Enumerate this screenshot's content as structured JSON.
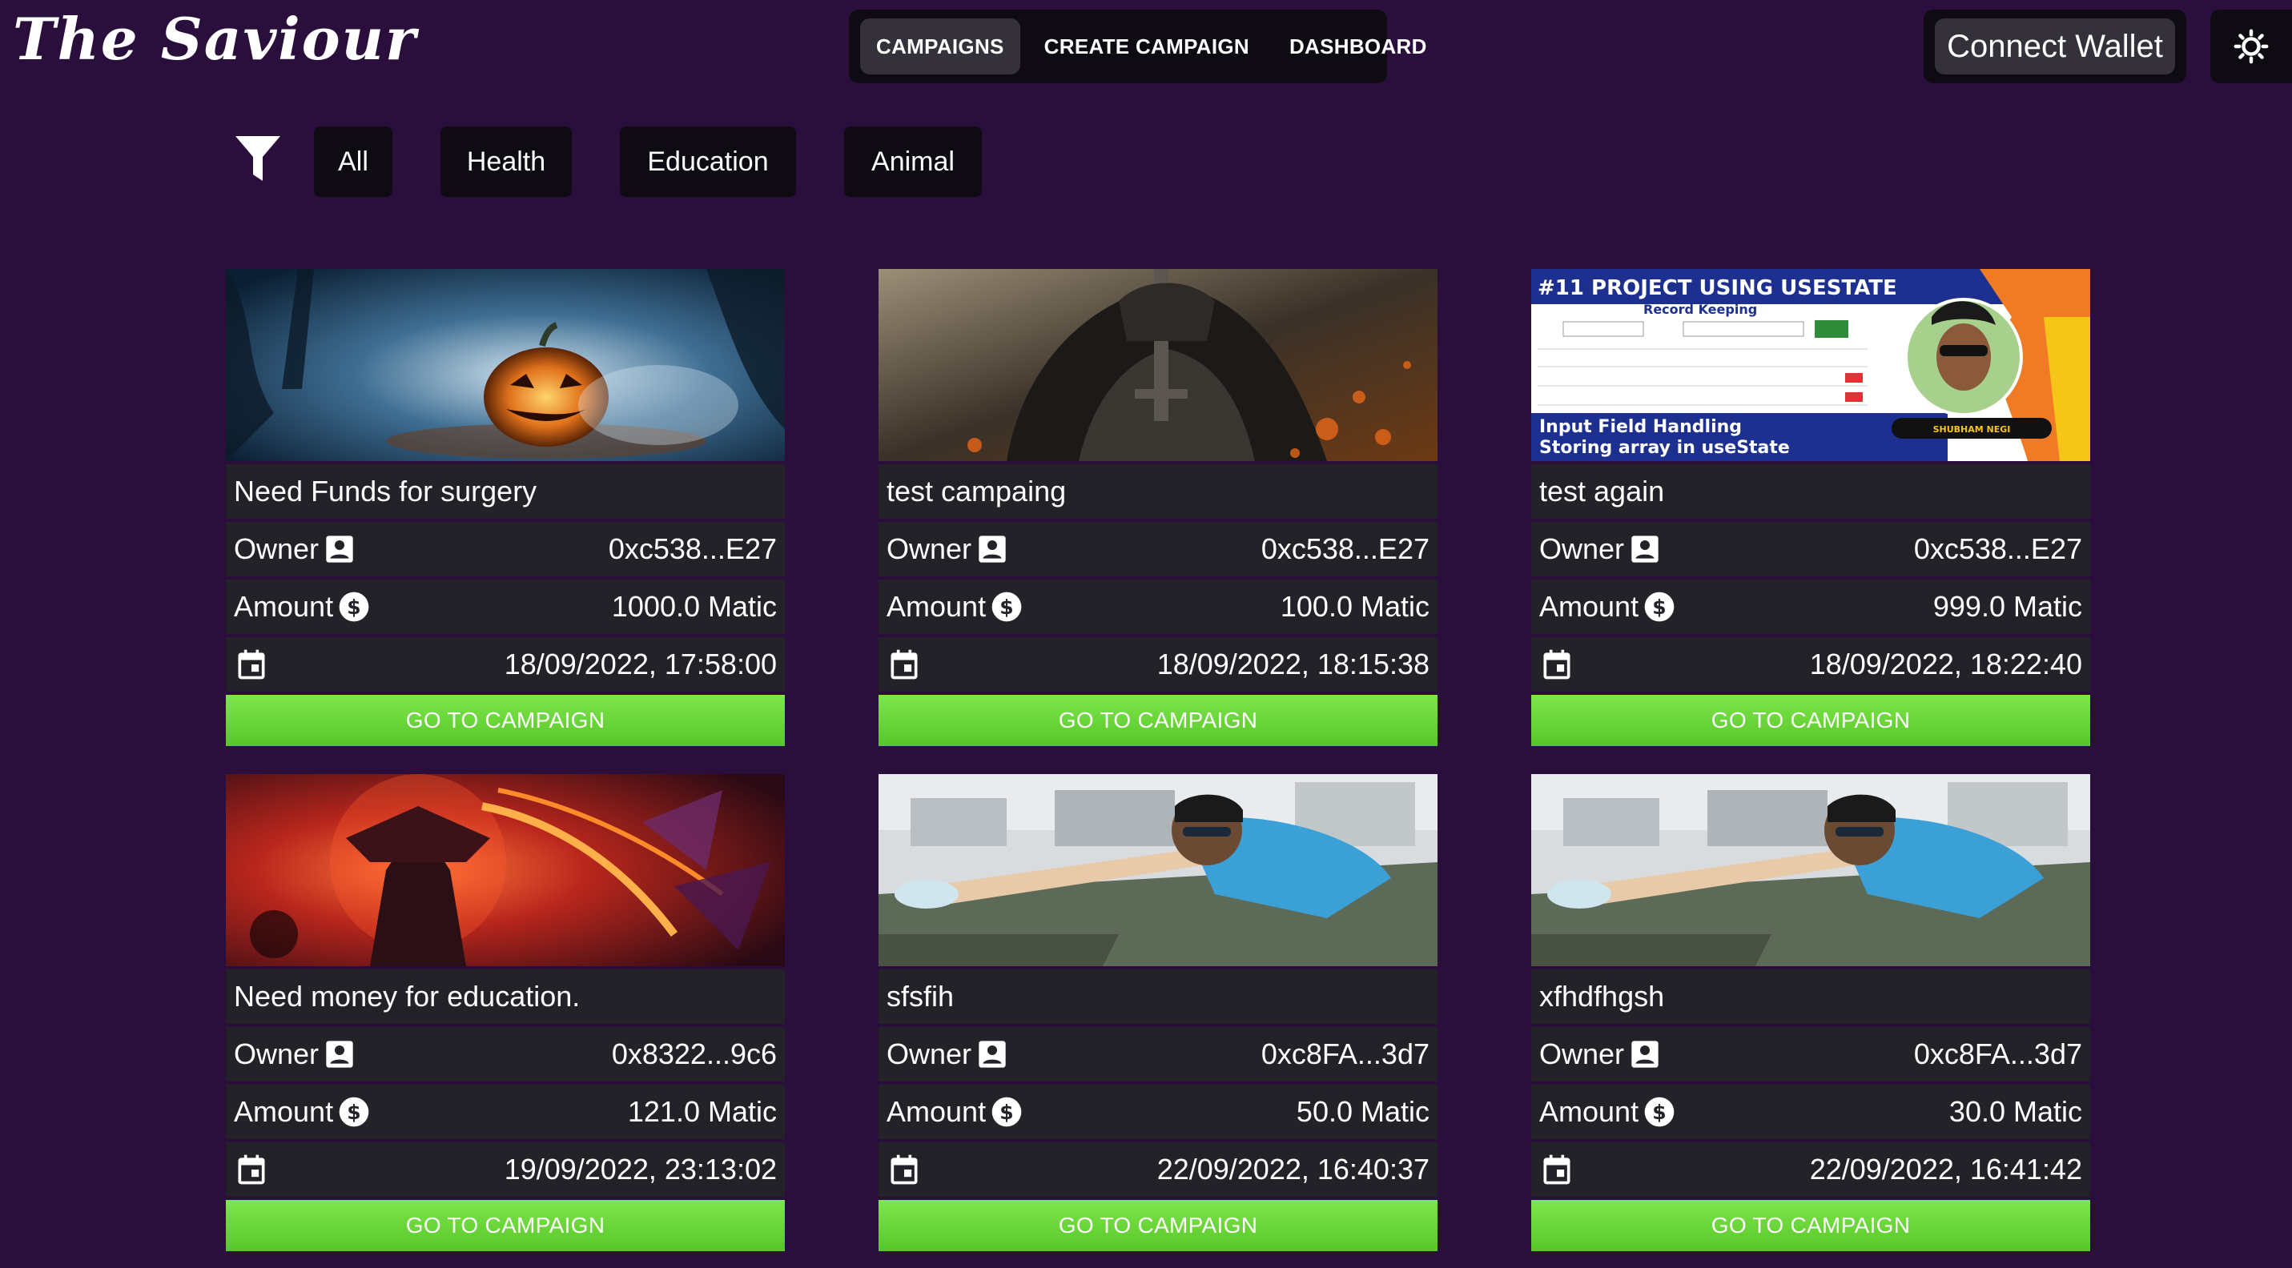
{
  "app": {
    "title": "The Saviour"
  },
  "nav": {
    "items": [
      {
        "label": "CAMPAIGNS",
        "active": true
      },
      {
        "label": "CREATE CAMPAIGN",
        "active": false
      },
      {
        "label": "DASHBOARD",
        "active": false
      }
    ]
  },
  "wallet": {
    "label": "Connect Wallet"
  },
  "theme_toggle": {
    "icon": "sun-icon"
  },
  "filters": {
    "icon": "filter-icon",
    "items": [
      {
        "label": "All"
      },
      {
        "label": "Health"
      },
      {
        "label": "Education"
      },
      {
        "label": "Animal"
      }
    ]
  },
  "card_labels": {
    "owner": "Owner",
    "amount": "Amount",
    "cta": "GO TO CAMPAIGN",
    "owner_icon": "person-badge-icon",
    "amount_icon": "dollar-circle-icon",
    "date_icon": "calendar-icon"
  },
  "campaigns": [
    {
      "title": "Need Funds for surgery",
      "owner": "0xc538...E27",
      "amount": "1000.0 Matic",
      "date": "18/09/2022, 17:58:00"
    },
    {
      "title": "test campaing",
      "owner": "0xc538...E27",
      "amount": "100.0 Matic",
      "date": "18/09/2022, 18:15:38"
    },
    {
      "title": "test again",
      "owner": "0xc538...E27",
      "amount": "999.0 Matic",
      "date": "18/09/2022, 18:22:40",
      "image_text": {
        "headline": "#11 PROJECT USING USESTATE",
        "sub": "Record Keeping",
        "line1": "Input Field Handling",
        "line2": "Storing array in useState",
        "badge": "SHUBHAM NEGI"
      }
    },
    {
      "title": "Need money for education.",
      "owner": "0x8322...9c6",
      "amount": "121.0 Matic",
      "date": "19/09/2022, 23:13:02"
    },
    {
      "title": "sfsfih",
      "owner": "0xc8FA...3d7",
      "amount": "50.0 Matic",
      "date": "22/09/2022, 16:40:37"
    },
    {
      "title": "xfhdfhgsh",
      "owner": "0xc8FA...3d7",
      "amount": "30.0 Matic",
      "date": "22/09/2022, 16:41:42"
    }
  ]
}
